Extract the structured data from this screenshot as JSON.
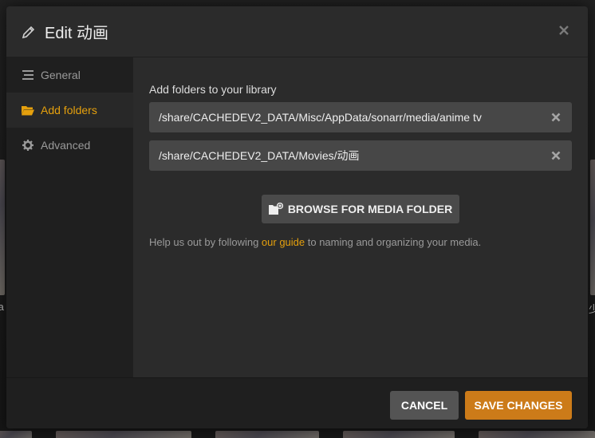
{
  "background": {
    "left_edge_text": "ta",
    "right_edge_text": "少"
  },
  "header": {
    "title": "Edit 动画",
    "close_icon": "close-icon"
  },
  "sidebar": {
    "items": [
      {
        "label": "General",
        "icon": "list-icon",
        "active": false
      },
      {
        "label": "Add folders",
        "icon": "folder-open-icon",
        "active": true
      },
      {
        "label": "Advanced",
        "icon": "gear-icon",
        "active": false
      }
    ]
  },
  "main": {
    "section_title": "Add folders to your library",
    "folders": [
      {
        "path": "/share/CACHEDEV2_DATA/Misc/AppData/sonarr/media/anime tv"
      },
      {
        "path": "/share/CACHEDEV2_DATA/Movies/动画"
      }
    ],
    "browse_label": "BROWSE FOR MEDIA FOLDER",
    "help_prefix": "Help us out by following ",
    "help_link": "our guide",
    "help_suffix": " to naming and organizing your media."
  },
  "footer": {
    "cancel_label": "CANCEL",
    "save_label": "SAVE CHANGES"
  },
  "colors": {
    "accent": "#e5a00d",
    "save_button": "#cc7b19",
    "modal_bg": "#282828"
  }
}
